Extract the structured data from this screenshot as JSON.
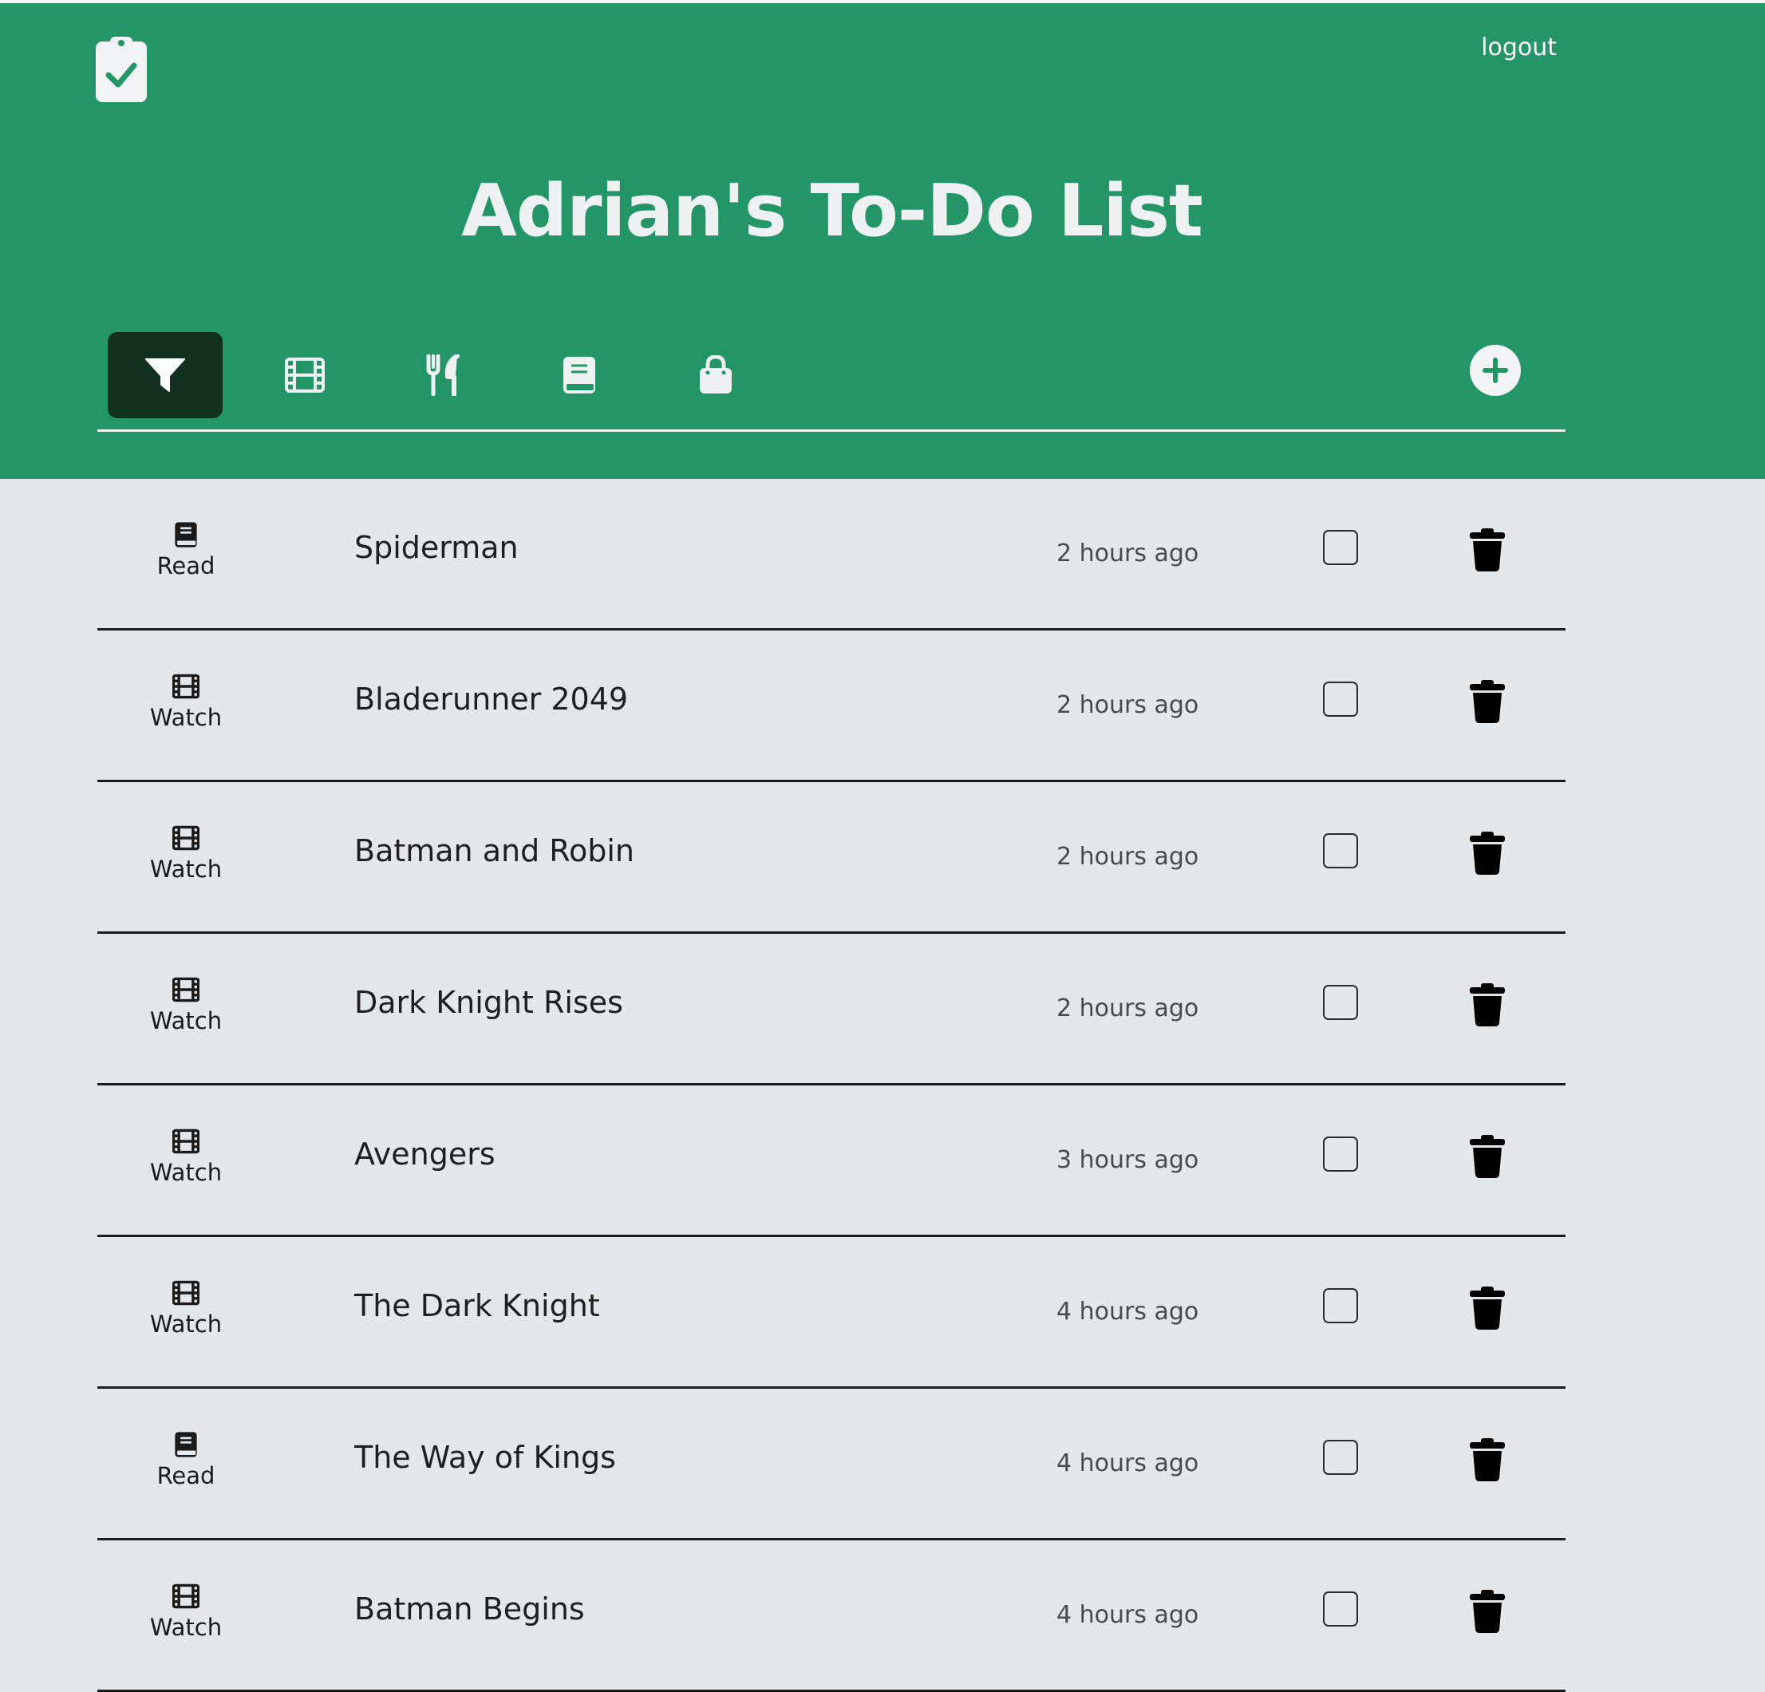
{
  "header": {
    "logo_icon": "clipboard-check-icon",
    "logout_label": "logout",
    "title": "Adrian's To-Do List",
    "accent_color": "#239566"
  },
  "filters": [
    {
      "icon": "filter-icon",
      "active": true
    },
    {
      "icon": "film-icon",
      "active": false
    },
    {
      "icon": "utensils-icon",
      "active": false
    },
    {
      "icon": "book-icon",
      "active": false
    },
    {
      "icon": "shopping-bag-icon",
      "active": false
    }
  ],
  "add_button": {
    "icon": "plus-circle-icon"
  },
  "todos": [
    {
      "category": "Read",
      "icon": "book-icon",
      "title": "Spiderman",
      "time": "2 hours ago",
      "done": false
    },
    {
      "category": "Watch",
      "icon": "film-icon",
      "title": "Bladerunner 2049",
      "time": "2 hours ago",
      "done": false
    },
    {
      "category": "Watch",
      "icon": "film-icon",
      "title": "Batman and Robin",
      "time": "2 hours ago",
      "done": false
    },
    {
      "category": "Watch",
      "icon": "film-icon",
      "title": "Dark Knight Rises",
      "time": "2 hours ago",
      "done": false
    },
    {
      "category": "Watch",
      "icon": "film-icon",
      "title": "Avengers",
      "time": "3 hours ago",
      "done": false
    },
    {
      "category": "Watch",
      "icon": "film-icon",
      "title": "The Dark Knight",
      "time": "4 hours ago",
      "done": false
    },
    {
      "category": "Read",
      "icon": "book-icon",
      "title": "The Way of Kings",
      "time": "4 hours ago",
      "done": false
    },
    {
      "category": "Watch",
      "icon": "film-icon",
      "title": "Batman Begins",
      "time": "4 hours ago",
      "done": false
    }
  ]
}
